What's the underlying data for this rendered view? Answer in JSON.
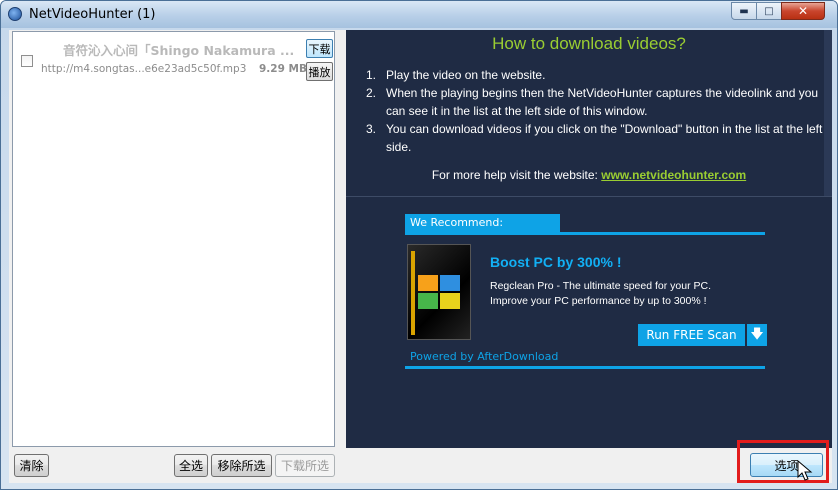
{
  "window": {
    "title": "NetVideoHunter (1)",
    "controls": {
      "minimize": "▬",
      "maximize": "□",
      "close": "✕"
    }
  },
  "list": {
    "items": [
      {
        "name": "音符沁入心间「Shingo Nakamura ...",
        "url": "http://m4.songtas...e6e23ad5c50f.mp3",
        "size": "9.29 MB",
        "download_label": "下载",
        "play_label": "播放"
      }
    ]
  },
  "bottom_buttons": {
    "clear": "清除",
    "select_all": "全选",
    "remove_selected": "移除所选",
    "download_selected": "下载所选",
    "options": "选项"
  },
  "help": {
    "heading": "How to download videos?",
    "steps": [
      {
        "num": "1.",
        "text": "Play the video on the website."
      },
      {
        "num": "2.",
        "text": "When the playing begins then the NetVideoHunter captures the videolink and you can see it in the list at the left side of this window."
      },
      {
        "num": "3.",
        "text": "You can download videos if you click on the \"Download\" button in the list at the left side."
      }
    ],
    "more_help_prefix": "For more help visit the website:",
    "website": "www.netvideohunter.com"
  },
  "ad": {
    "recommend": "We Recommend:",
    "headline": "Boost PC by 300% !",
    "line1": "Regclean Pro - The ultimate speed for your PC.",
    "line2": "Improve your PC performance by up to 300% !",
    "scan_button": "Run FREE Scan",
    "scan_icon": "download-arrow-icon",
    "powered": "Powered by AfterDownload"
  },
  "colors": {
    "accent_green": "#9acd32",
    "ad_blue": "#0ea3e6",
    "panel_bg": "#1f2b44",
    "highlight_red": "#e21c1c"
  }
}
